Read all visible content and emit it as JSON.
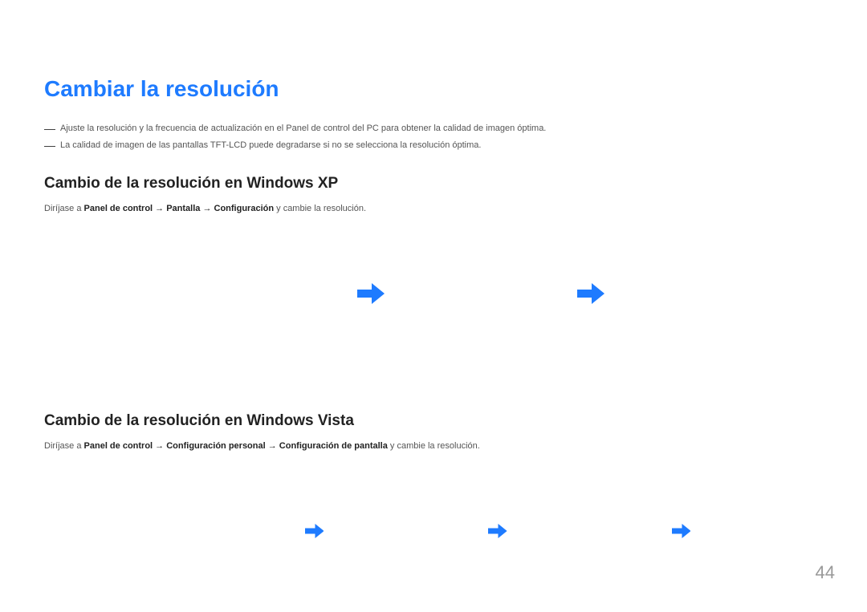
{
  "main_title": "Cambiar la resolución",
  "notes": {
    "item1": "Ajuste la resolución y la frecuencia de actualización en el Panel de control del PC para obtener la calidad de imagen óptima.",
    "item2": "La calidad de imagen de las pantallas TFT-LCD puede degradarse si no se selecciona la resolución óptima."
  },
  "section_xp": {
    "title": "Cambio de la resolución en Windows XP",
    "instruction_prefix": "Diríjase a ",
    "instruction_bold": "Panel de control → Pantalla → Configuración",
    "instruction_suffix": " y cambie la resolución."
  },
  "section_vista": {
    "title": "Cambio de la resolución en Windows Vista",
    "instruction_prefix": "Diríjase a ",
    "instruction_bold": "Panel de control → Configuración personal → Configuración de pantalla",
    "instruction_suffix": " y cambie la resolución."
  },
  "page_number": "44",
  "note_dash": "―"
}
